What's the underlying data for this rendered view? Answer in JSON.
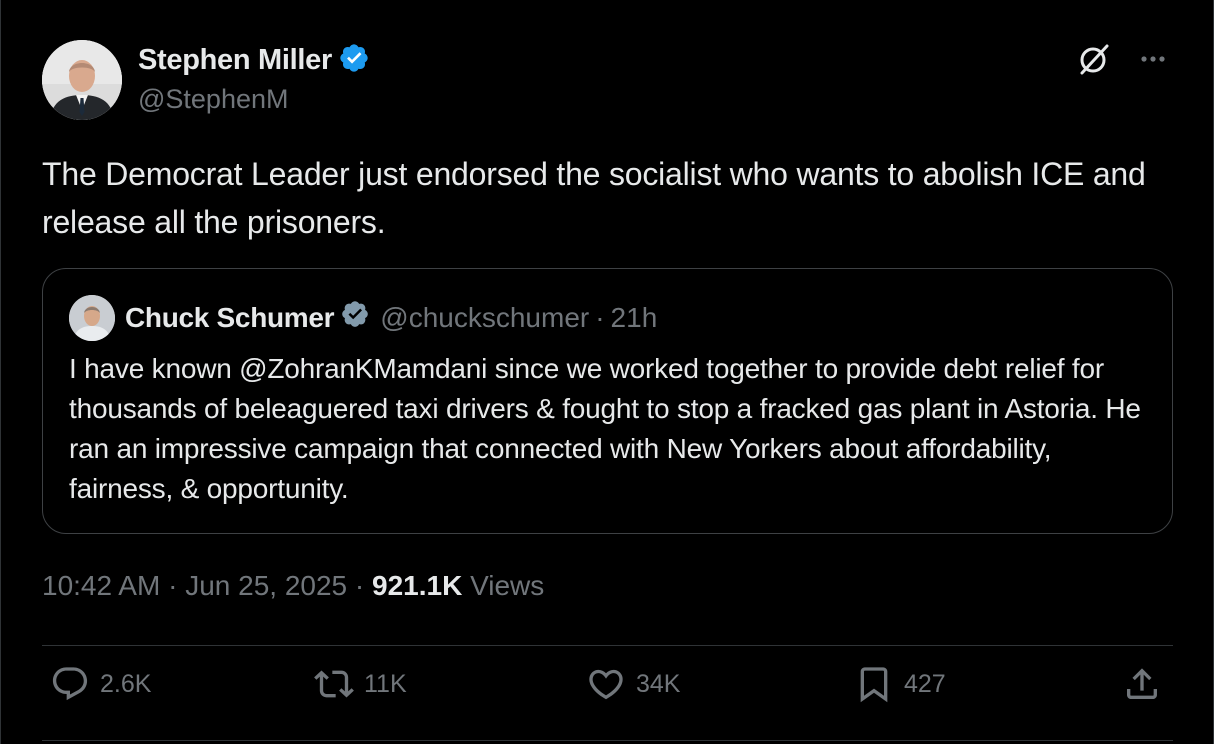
{
  "author": {
    "name": "Stephen Miller",
    "handle": "@StephenM",
    "verified": true
  },
  "tweet": {
    "text": "The Democrat Leader just endorsed the socialist who wants to abolish ICE and release all the prisoners."
  },
  "quoted": {
    "name": "Chuck Schumer",
    "handle": "@chuckschumer",
    "separator": "·",
    "time": "21h",
    "text": "I have known @ZohranKMamdani since we worked together to provide debt relief for thousands of beleaguered taxi drivers & fought to stop a fracked gas plant in Astoria. He ran an impressive campaign that connected with New Yorkers about affordability, fairness, & opportunity."
  },
  "meta": {
    "time": "10:42 AM",
    "sep1": "·",
    "date": "Jun 25, 2025",
    "sep2": "·",
    "views_count": "921.1K",
    "views_label": "Views"
  },
  "actions": {
    "replies": "2.6K",
    "reposts": "11K",
    "likes": "34K",
    "bookmarks": "427"
  },
  "colors": {
    "background": "#000000",
    "text": "#e7e9ea",
    "secondary": "#71767b",
    "verified_blue": "#1d9bf0",
    "verified_gray": "#829aab",
    "border": "#2f3336"
  },
  "icons": [
    "grok-icon",
    "more-icon",
    "verified-badge-icon",
    "reply-icon",
    "repost-icon",
    "like-icon",
    "bookmark-icon",
    "share-icon"
  ]
}
